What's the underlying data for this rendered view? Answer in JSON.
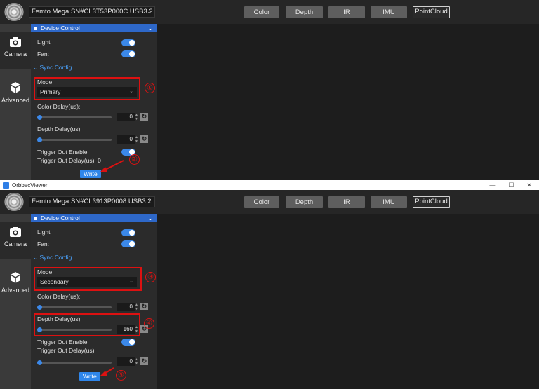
{
  "top": {
    "device": "Femto Mega SN#CL3T53P000C USB3.2",
    "mode_value": "Primary",
    "color_delay_value": "0",
    "depth_delay_value": "0",
    "trigger_out_delay_label": "Trigger Out Delay(us): 0",
    "markers": [
      "①",
      "②"
    ]
  },
  "bottom": {
    "window_title": "OrbbecViewer",
    "device": "Femto Mega SN#CL3913P0008 USB3.2",
    "mode_value": "Secondary",
    "color_delay_value": "0",
    "depth_delay_value": "160",
    "trigger_out_delay_label": "Trigger Out Delay(us):",
    "trigger_out_delay_value": "0",
    "markers": [
      "③",
      "④",
      "⑤"
    ]
  },
  "toolbar": {
    "color": "Color",
    "depth": "Depth",
    "ir": "IR",
    "imu": "IMU",
    "pointcloud": "PointCloud"
  },
  "nav": {
    "camera": "Camera",
    "advanced": "Advanced"
  },
  "panel": {
    "device_control": "Device Control",
    "light": "Light:",
    "fan": "Fan:",
    "sync_config": "Sync Config",
    "mode": "Mode:",
    "color_delay": "Color Delay(us):",
    "depth_delay": "Depth Delay(us):",
    "trigger_out_enable": "Trigger Out Enable",
    "write": "Write"
  },
  "window_controls": {
    "minimize": "—",
    "maximize": "☐",
    "close": "✕"
  },
  "colors": {
    "accent": "#2e68c9",
    "toggle_on": "#3b88e8",
    "annotation": "#dd1111"
  },
  "states": {
    "light_on": true,
    "fan_on": true,
    "trigger_out_enable_on": true
  }
}
